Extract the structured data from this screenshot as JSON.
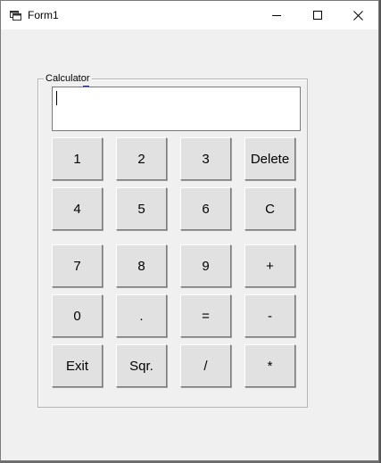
{
  "window": {
    "title": "Form1"
  },
  "titlebar_buttons": {
    "minimize": "minimize-icon",
    "maximize": "maximize-icon",
    "close": "close-icon"
  },
  "calculator": {
    "group_label": "Calculator",
    "display_value": "",
    "buttons": {
      "one": "1",
      "two": "2",
      "three": "3",
      "delete": "Delete",
      "four": "4",
      "five": "5",
      "six": "6",
      "clear": "C",
      "seven": "7",
      "eight": "8",
      "nine": "9",
      "plus": "+",
      "zero": "0",
      "dot": ".",
      "equals": "=",
      "minus": "-",
      "exit": "Exit",
      "sqr": "Sqr.",
      "divide": "/",
      "multiply": "*"
    }
  }
}
